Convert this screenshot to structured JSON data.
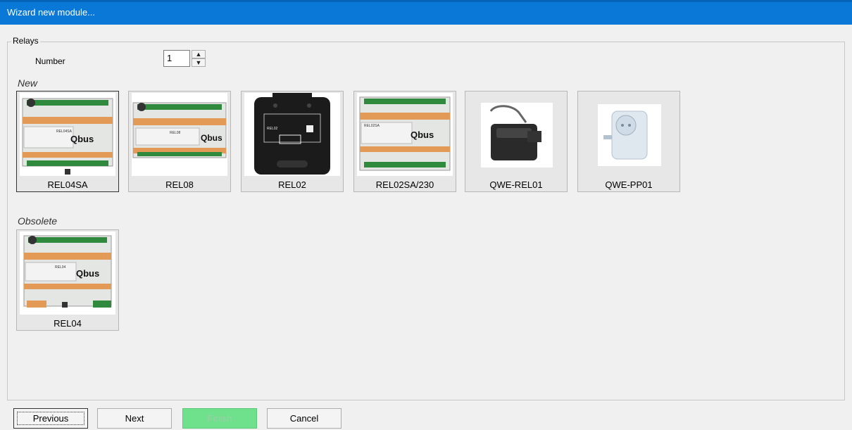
{
  "window": {
    "title": "Wizard new module..."
  },
  "relays": {
    "group_label": "Relays",
    "number_label": "Number",
    "number_value": "1",
    "spin_up": "▲",
    "spin_down": "▼"
  },
  "sections": {
    "new_label": "New",
    "obsolete_label": "Obsolete"
  },
  "modules_new": [
    {
      "name": "REL04SA",
      "selected": true
    },
    {
      "name": "REL08"
    },
    {
      "name": "REL02"
    },
    {
      "name": "REL02SA/230"
    },
    {
      "name": "QWE-REL01"
    },
    {
      "name": "QWE-PP01"
    }
  ],
  "modules_obsolete": [
    {
      "name": "REL04"
    }
  ],
  "device_text": {
    "qbus_logo": "Qbus",
    "rel04sa": "REL04SA",
    "rel08": "REL08",
    "rel02": "REL02",
    "rel02sa": "REL02SA",
    "rel04": "REL04"
  },
  "buttons": {
    "previous": "Previous",
    "next": "Next",
    "finish": "Finish",
    "cancel": "Cancel"
  },
  "colors": {
    "titlebar": "#0a78d7",
    "finish_button": "#6fe08b"
  }
}
